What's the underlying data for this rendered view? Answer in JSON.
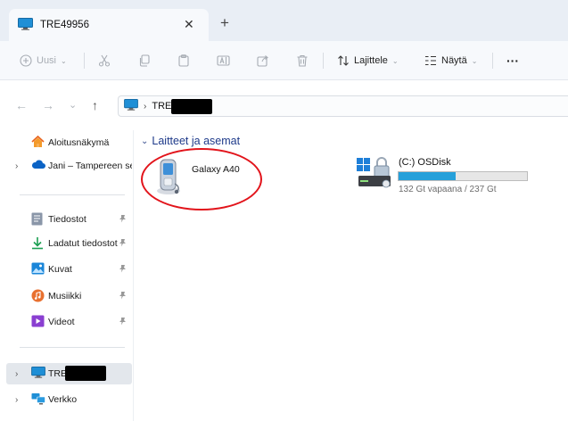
{
  "tab": {
    "title": "TRE49956",
    "close": "✕",
    "new_tab": "+"
  },
  "toolbar": {
    "new_label": "Uusi",
    "sort_label": "Lajittele",
    "view_label": "Näytä",
    "more_label": "···",
    "chevron": "⌄"
  },
  "address": {
    "back": "←",
    "forward": "→",
    "recent": "⌄",
    "up": "↑",
    "separator": "›",
    "path_text": "TRE"
  },
  "sidebar": {
    "home": "Aloitusnäkymä",
    "onedrive": "Jani – Tampereen seudun",
    "documents": "Tiedostot",
    "downloads": "Ladatut tiedostot",
    "pictures": "Kuvat",
    "music": "Musiikki",
    "videos": "Videot",
    "this_pc": "TRE",
    "network": "Verkko",
    "expand": "›",
    "pin": "📌"
  },
  "content": {
    "group_chevron": "⌄",
    "group_label": "Laitteet ja asemat",
    "device_name": "Galaxy A40",
    "drive": {
      "name": "(C:) OSDisk",
      "free_text": "132 Gt vapaana / 237 Gt",
      "used_fraction": 0.443
    }
  },
  "colors": {
    "accent": "#26a0da",
    "annotation": "#e2141b",
    "group_heading": "#1e3a8a"
  }
}
